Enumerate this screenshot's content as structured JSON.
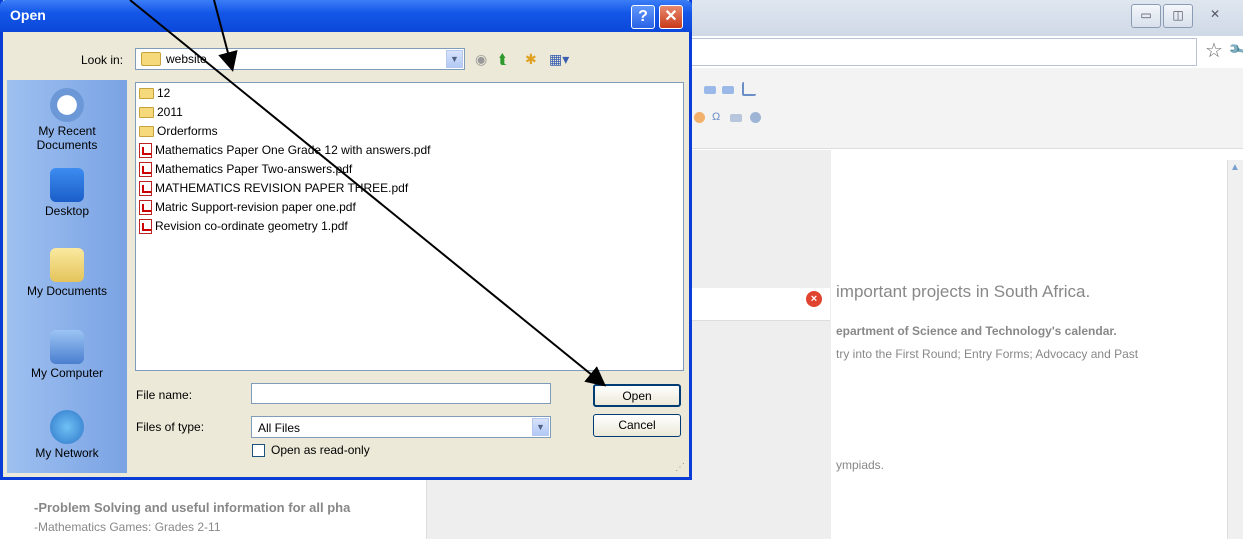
{
  "dialog": {
    "title": "Open",
    "help_label": "?",
    "close_label": "✕",
    "look_in_label": "Look in:",
    "look_in_value": "website",
    "places": [
      {
        "name": "My Recent\nDocuments"
      },
      {
        "name": "Desktop"
      },
      {
        "name": "My Documents"
      },
      {
        "name": "My Computer"
      },
      {
        "name": "My Network"
      }
    ],
    "files": [
      {
        "name": "12",
        "kind": "folder"
      },
      {
        "name": "2011",
        "kind": "folder"
      },
      {
        "name": "Orderforms",
        "kind": "folder"
      },
      {
        "name": "Mathematics Paper One Grade 12 with answers.pdf",
        "kind": "pdf"
      },
      {
        "name": "Mathematics Paper Two-answers.pdf",
        "kind": "pdf"
      },
      {
        "name": "MATHEMATICS REVISION PAPER THREE.pdf",
        "kind": "pdf"
      },
      {
        "name": "Matric Support-revision paper one.pdf",
        "kind": "pdf"
      },
      {
        "name": "Revision co-ordinate geometry 1.pdf",
        "kind": "pdf"
      }
    ],
    "file_name_label": "File name:",
    "file_name_value": "",
    "files_of_type_label": "Files of type:",
    "files_of_type_value": "All Files",
    "open_button": "Open",
    "cancel_button": "Cancel",
    "read_only_label": "Open as read-only"
  },
  "background": {
    "projects_text": "important projects in South Africa.",
    "science_text": "epartment of Science and Technology's calendar.",
    "entry_text": "try into the First Round; Entry Forms; Advocacy and Past",
    "olympiads_text": "ympiads.",
    "problem_text": "-Problem Solving and useful information for all pha",
    "games_text": "-Mathematics Games: Grades 2-11"
  },
  "colors": {
    "dialog_title_blue": "#0b47d9",
    "dialog_body": "#ece9d8",
    "places_bar": "#7aa3e4"
  }
}
